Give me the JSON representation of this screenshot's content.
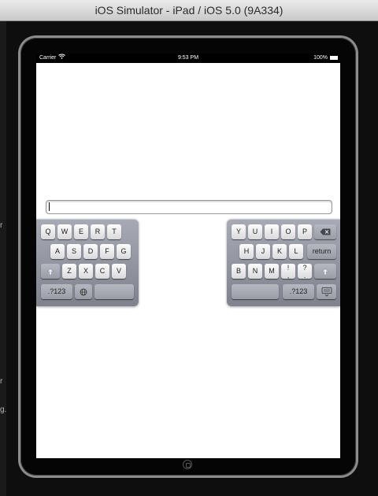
{
  "window": {
    "title": "iOS Simulator - iPad / iOS 5.0 (9A334)"
  },
  "statusbar": {
    "carrier": "Carrier",
    "wifi_icon": "wifi-icon",
    "time": "9:53 PM",
    "battery": "100%"
  },
  "textfield": {
    "value": ""
  },
  "keyboard_left": {
    "row1": [
      "Q",
      "W",
      "E",
      "R",
      "T"
    ],
    "row2": [
      "A",
      "S",
      "D",
      "F",
      "G"
    ],
    "row3": [
      "Z",
      "X",
      "C",
      "V"
    ],
    "numbers_label": ".?123",
    "globe_icon": "globe-icon",
    "shift_icon": "shift-icon"
  },
  "keyboard_right": {
    "row1": [
      "Y",
      "U",
      "I",
      "O",
      "P"
    ],
    "row2": [
      "H",
      "J",
      "K",
      "L"
    ],
    "return_label": "return",
    "row3": [
      "B",
      "N",
      "M",
      "!",
      "?"
    ],
    "row3_alt": [
      ",",
      "."
    ],
    "numbers_label": ".?123",
    "delete_icon": "delete-icon",
    "shift_icon": "shift-icon",
    "hide_keyboard_icon": "hide-keyboard-icon"
  },
  "background_ghost": [
    "r",
    "r",
    "g."
  ]
}
